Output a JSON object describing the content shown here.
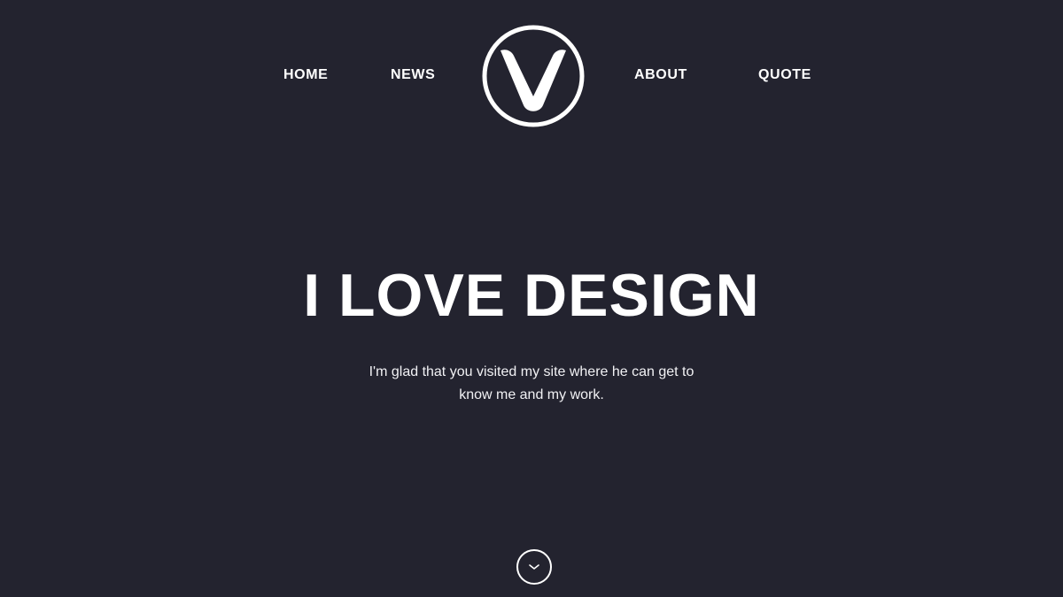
{
  "nav": {
    "items": [
      {
        "label": "HOME"
      },
      {
        "label": "NEWS"
      },
      {
        "label": "ABOUT"
      },
      {
        "label": "QUOTE"
      }
    ],
    "logo": {
      "letter": "V",
      "icon": "v-logo-icon"
    }
  },
  "hero": {
    "title": "I LOVE DESIGN",
    "subtitle": "I'm glad that you visited my site where he can get to know me and my work."
  },
  "scroll_button": {
    "icon": "chevron-down-icon"
  },
  "colors": {
    "background": "#23232f",
    "text": "#ffffff"
  }
}
